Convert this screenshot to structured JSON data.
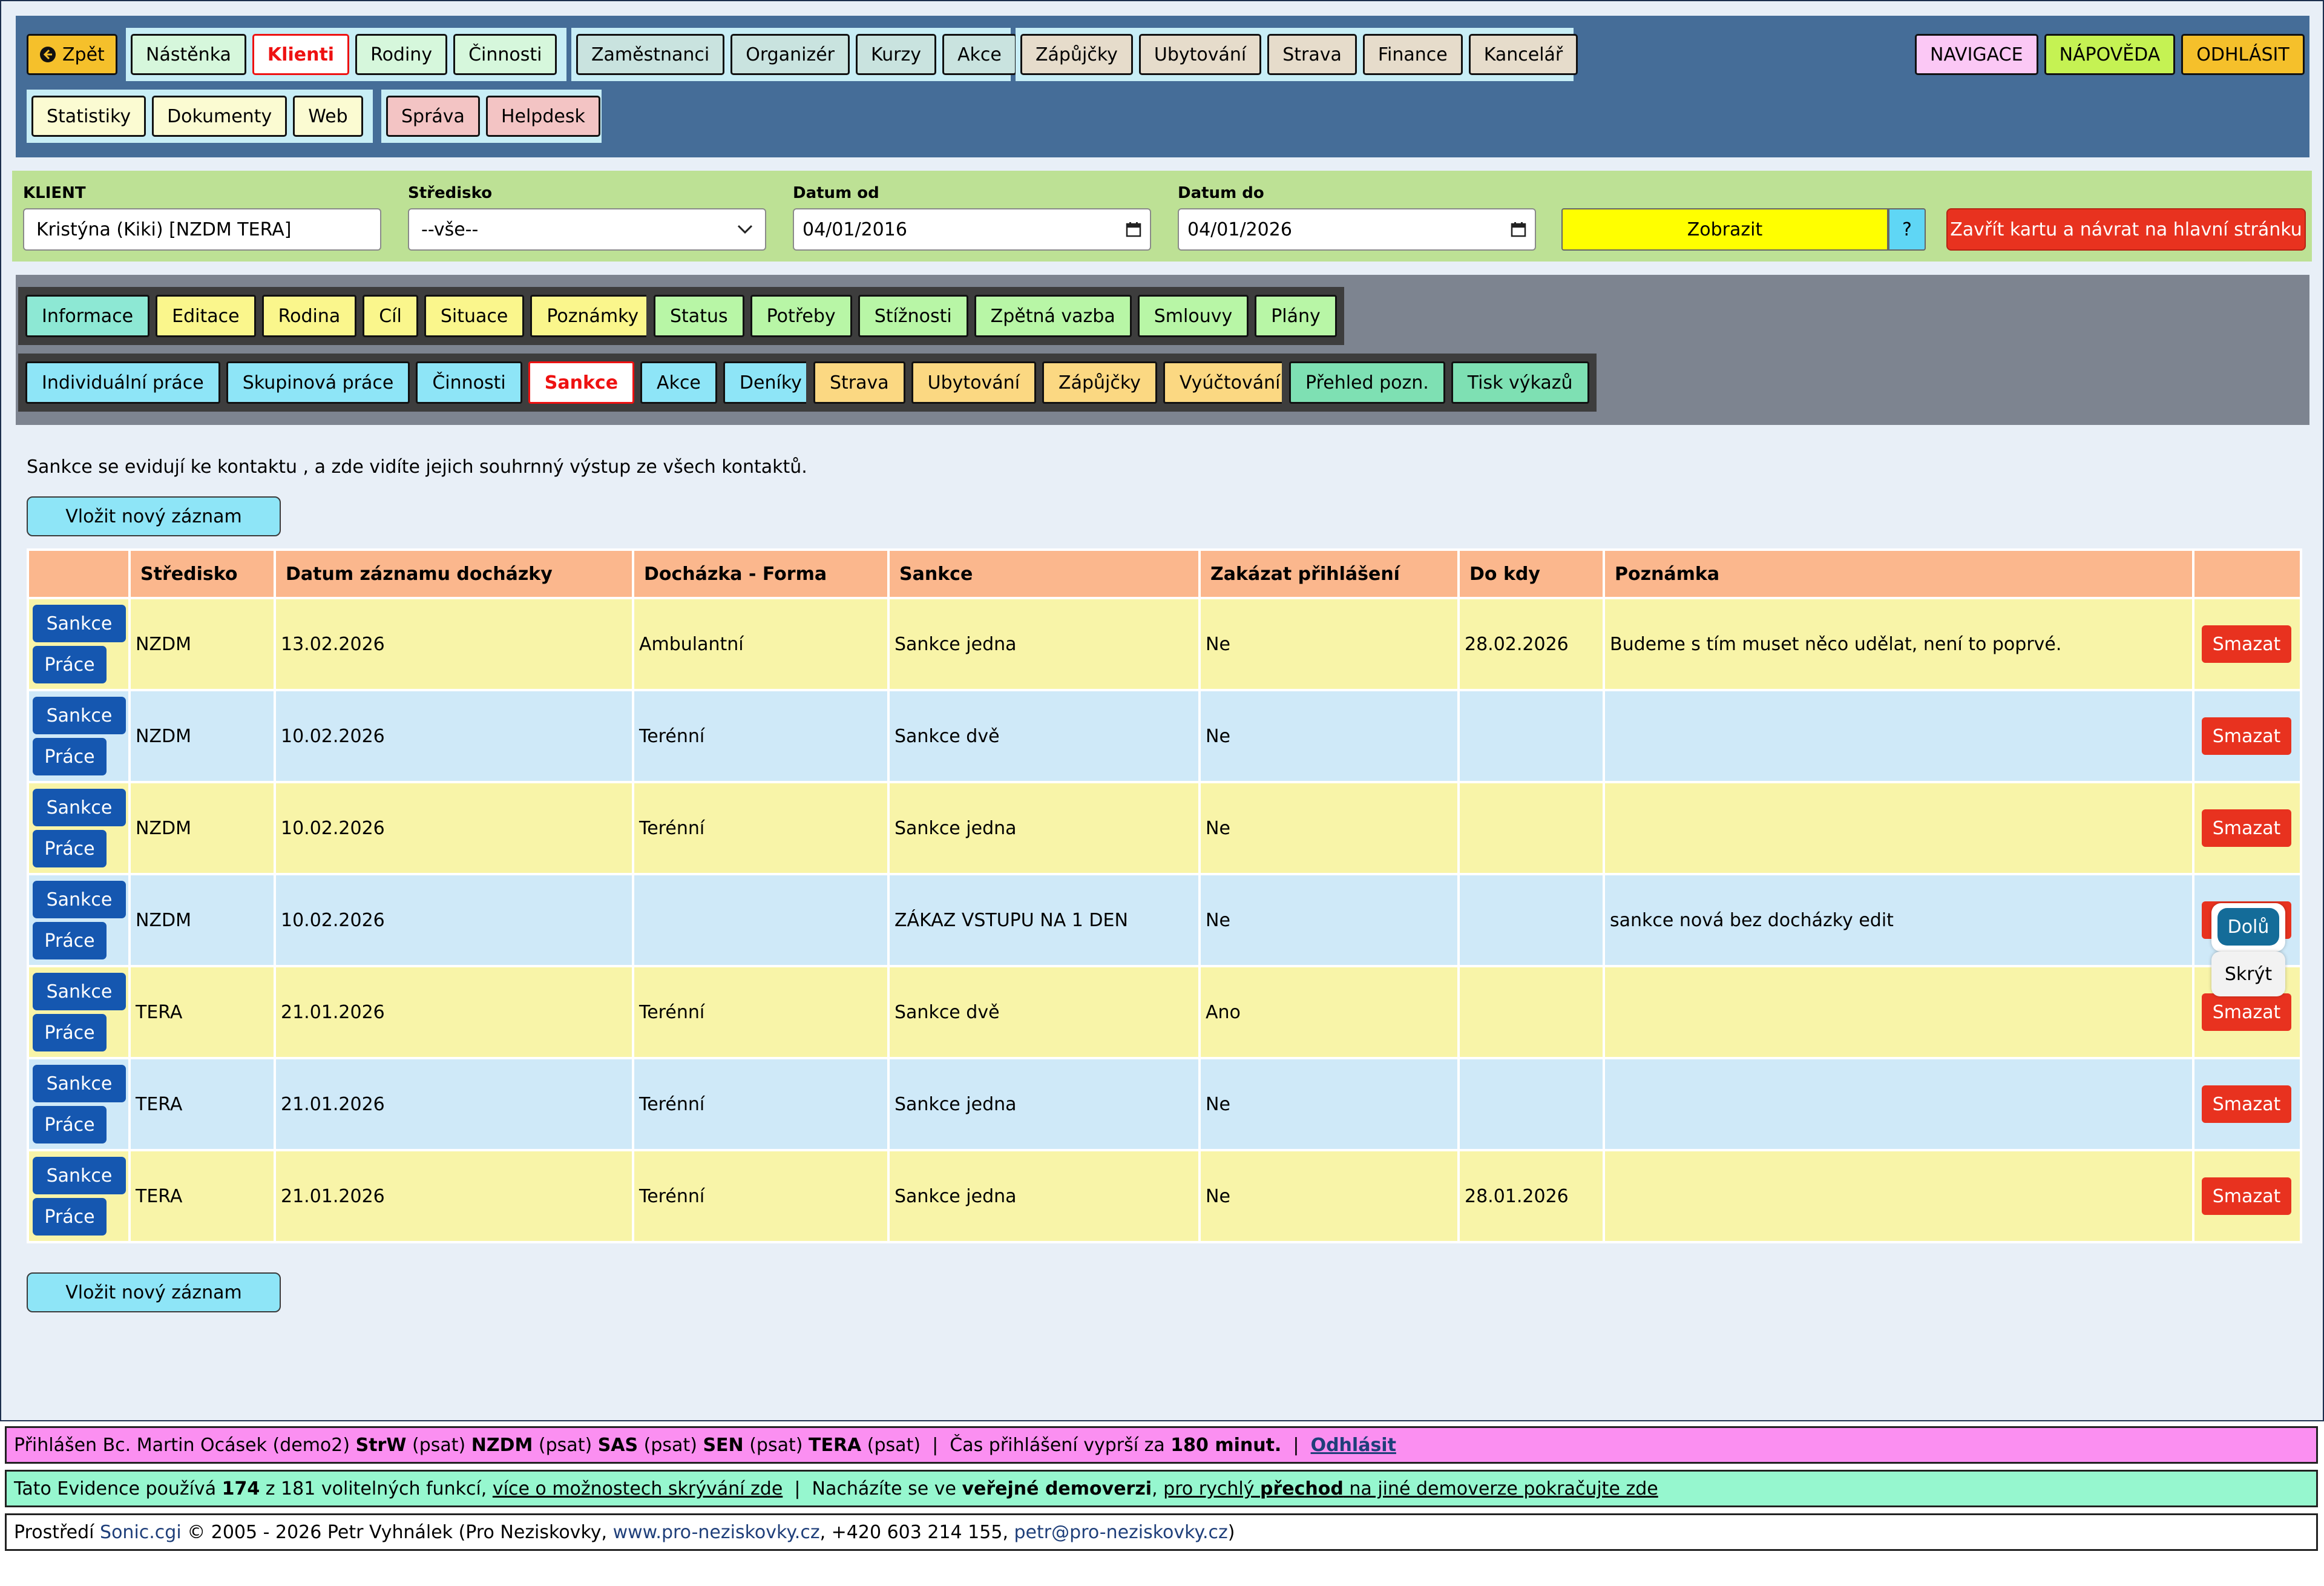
{
  "colors": {
    "top_nav_bg": "#456d98",
    "filter_bg": "#bde195",
    "card_nav_bg": "#7d8490",
    "table_header": "#fbb78d",
    "row_yellow": "#f8f4a8",
    "row_blue": "#cfe9f8",
    "delete_red": "#e8321f",
    "row_button_blue": "#1557b0"
  },
  "topnav": {
    "back": {
      "icon": "arrow-left-circle-icon",
      "label": "Zpět"
    },
    "group1": [
      "Nástěnka",
      "Klienti",
      "Rodiny",
      "Činnosti"
    ],
    "group2": [
      "Zaměstnanci",
      "Organizér",
      "Kurzy",
      "Akce"
    ],
    "group3": [
      "Zápůjčky",
      "Ubytování",
      "Strava",
      "Finance",
      "Kancelář"
    ],
    "group4": [
      "Statistiky",
      "Dokumenty",
      "Web"
    ],
    "group5": [
      "Správa",
      "Helpdesk"
    ],
    "right": [
      "NAVIGACE",
      "NÁPOVĚDA",
      "ODHLÁSIT"
    ]
  },
  "filter": {
    "client_label": "KLIENT",
    "client_value": "Kristýna (Kiki) [NZDM TERA]",
    "center_label": "Středisko",
    "center_value": "--vše--",
    "date_from_label": "Datum od",
    "date_from_value": "04/01/2016",
    "date_to_label": "Datum do",
    "date_to_value": "04/01/2026",
    "show_button": "Zobrazit",
    "help_button": "?",
    "close_button": "Zavřít kartu a návrat na hlavní stránku"
  },
  "cardnav": {
    "row1_group1": [
      "Informace",
      "Editace",
      "Rodina",
      "Cíl",
      "Situace",
      "Poznámky"
    ],
    "row1_group2": [
      "Status",
      "Potřeby",
      "Stížnosti",
      "Zpětná vazba",
      "Smlouvy",
      "Plány"
    ],
    "row2_group1": [
      "Individuální práce",
      "Skupinová práce",
      "Činnosti",
      "Sankce",
      "Akce",
      "Deníky"
    ],
    "row2_group2": [
      "Strava",
      "Ubytování",
      "Zápůjčky",
      "Vyúčtování"
    ],
    "row2_group3": [
      "Přehled pozn.",
      "Tisk výkazů"
    ]
  },
  "intro_text": "Sankce se evidují ke kontaktu , a zde vidíte jejich souhrnný výstup ze všech kontaktů.",
  "new_record_button": "Vložit nový záznam",
  "table": {
    "headers": [
      "",
      "Středisko",
      "Datum záznamu docházky",
      "Docházka - Forma",
      "Sankce",
      "Zakázat přihlášení",
      "Do kdy",
      "Poznámka",
      ""
    ],
    "row_button_sanction": "Sankce",
    "row_button_work": "Práce",
    "delete_label": "Smazat",
    "rows": [
      {
        "center": "NZDM",
        "date": "13.02.2026",
        "form": "Ambulantní",
        "sanction": "Sankce jedna",
        "block_login": "Ne",
        "until": "28.02.2026",
        "note": "Budeme s tím muset něco udělat, není to poprvé."
      },
      {
        "center": "NZDM",
        "date": "10.02.2026",
        "form": "Terénní",
        "sanction": "Sankce dvě",
        "block_login": "Ne",
        "until": "",
        "note": ""
      },
      {
        "center": "NZDM",
        "date": "10.02.2026",
        "form": "Terénní",
        "sanction": "Sankce jedna",
        "block_login": "Ne",
        "until": "",
        "note": ""
      },
      {
        "center": "NZDM",
        "date": "10.02.2026",
        "form": "",
        "sanction": "ZÁKAZ VSTUPU NA 1 DEN",
        "block_login": "Ne",
        "until": "",
        "note": "sankce nová bez docházky edit"
      },
      {
        "center": "TERA",
        "date": "21.01.2026",
        "form": "Terénní",
        "sanction": "Sankce dvě",
        "block_login": "Ano",
        "until": "",
        "note": ""
      },
      {
        "center": "TERA",
        "date": "21.01.2026",
        "form": "Terénní",
        "sanction": "Sankce jedna",
        "block_login": "Ne",
        "until": "",
        "note": ""
      },
      {
        "center": "TERA",
        "date": "21.01.2026",
        "form": "Terénní",
        "sanction": "Sankce jedna",
        "block_login": "Ne",
        "until": "28.01.2026",
        "note": ""
      }
    ]
  },
  "floating": {
    "down": "Dolů",
    "hide": "Skrýt"
  },
  "footer": {
    "login": {
      "p1": "Přihlášen Bc. Martin Ocásek (demo2) ",
      "c1": "StrW",
      "p2": " (psat) ",
      "c2": "NZDM",
      "p3": " (psat) ",
      "c3": "SAS",
      "p4": " (psat) ",
      "c4": "SEN",
      "p5": " (psat) ",
      "c5": "TERA",
      "p6": " (psat)  |  Čas přihlášení vyprší za ",
      "minutes": "180 minut.",
      "p7": "  |  ",
      "logout": "Odhlásit"
    },
    "features": {
      "p1": "Tato Evidence používá ",
      "count": "174",
      "p2": " z 181 volitelných funkcí, ",
      "link1": "více o možnostech skrývání zde",
      "p3": "  |  Nacházíte se ve ",
      "public": "veřejné demoverzi",
      "p4": ", ",
      "link2a": "pro rychlý ",
      "link2b": "přechod",
      "link2c": " na jiné demoverze pokračujte zde"
    },
    "copyright": {
      "p1": "Prostředí ",
      "sonic": "Sonic.cgi",
      "p2": " © 2005 - 2026 Petr Vyhnálek (Pro Neziskovky, ",
      "web": "www.pro-neziskovky.cz",
      "p3": ", +420 603 214 155, ",
      "email": "petr@pro-neziskovky.cz",
      "p4": ")"
    }
  }
}
